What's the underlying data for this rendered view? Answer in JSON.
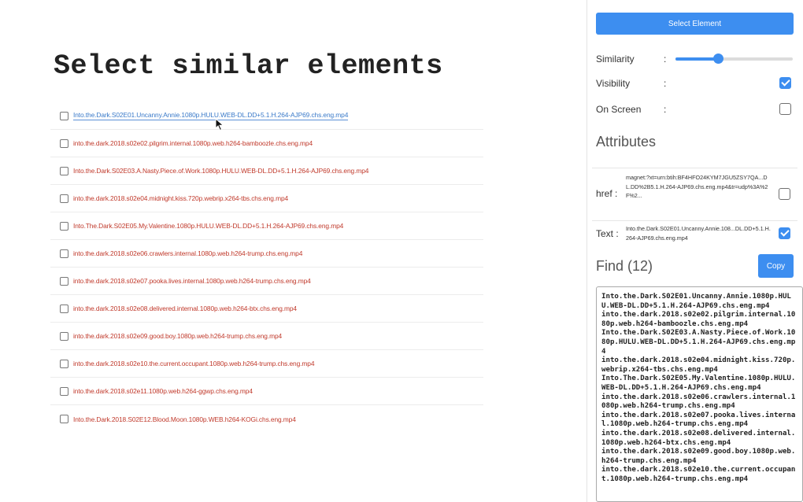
{
  "page": {
    "title": "Select similar elements",
    "files": [
      "Into.the.Dark.S02E01.Uncanny.Annie.1080p.HULU.WEB-DL.DD+5.1.H.264-AJP69.chs.eng.mp4",
      "into.the.dark.2018.s02e02.pilgrim.internal.1080p.web.h264-bamboozle.chs.eng.mp4",
      "Into.the.Dark.S02E03.A.Nasty.Piece.of.Work.1080p.HULU.WEB-DL.DD+5.1.H.264-AJP69.chs.eng.mp4",
      "into.the.dark.2018.s02e04.midnight.kiss.720p.webrip.x264-tbs.chs.eng.mp4",
      "Into.The.Dark.S02E05.My.Valentine.1080p.HULU.WEB-DL.DD+5.1.H.264-AJP69.chs.eng.mp4",
      "into.the.dark.2018.s02e06.crawlers.internal.1080p.web.h264-trump.chs.eng.mp4",
      "into.the.dark.2018.s02e07.pooka.lives.internal.1080p.web.h264-trump.chs.eng.mp4",
      "into.the.dark.2018.s02e08.delivered.internal.1080p.web.h264-btx.chs.eng.mp4",
      "into.the.dark.2018.s02e09.good.boy.1080p.web.h264-trump.chs.eng.mp4",
      "into.the.dark.2018.s02e10.the.current.occupant.1080p.web.h264-trump.chs.eng.mp4",
      "into.the.dark.2018.s02e11.1080p.web.h264-ggwp.chs.eng.mp4",
      "Into.the.Dark.2018.S02E12.Blood.Moon.1080p.WEB.h264-KOGi.chs.eng.mp4"
    ],
    "hovered_index": 0
  },
  "panel": {
    "select_button": "Select Element",
    "similarity": {
      "label": "Similarity",
      "colon": ":",
      "value": 0.36
    },
    "visibility": {
      "label": "Visibility",
      "colon": ":",
      "checked": true
    },
    "on_screen": {
      "label": "On Screen",
      "colon": ":",
      "checked": false
    },
    "attributes_heading": "Attributes",
    "attributes": [
      {
        "key": "href :",
        "value": "magnet:?xt=urn:btih:BF4HFO24KYM7JGU5ZSY7QA...DL.DD%2B5.1.H.264-AJP69.chs.eng.mp4&tr=udp%3A%2F%2...",
        "checked": false
      },
      {
        "key": "Text :",
        "value": "Into.the.Dark.S02E01.Uncanny.Annie.108...DL.DD+5.1.H.264-AJP69.chs.eng.mp4",
        "checked": true
      }
    ],
    "find_heading": "Find (12)",
    "copy_button": "Copy",
    "find_output": "Into.the.Dark.S02E01.Uncanny.Annie.1080p.HULU.WEB-DL.DD+5.1.H.264-AJP69.chs.eng.mp4\ninto.the.dark.2018.s02e02.pilgrim.internal.1080p.web.h264-bamboozle.chs.eng.mp4\nInto.the.Dark.S02E03.A.Nasty.Piece.of.Work.1080p.HULU.WEB-DL.DD+5.1.H.264-AJP69.chs.eng.mp4\ninto.the.dark.2018.s02e04.midnight.kiss.720p.webrip.x264-tbs.chs.eng.mp4\nInto.The.Dark.S02E05.My.Valentine.1080p.HULU.WEB-DL.DD+5.1.H.264-AJP69.chs.eng.mp4\ninto.the.dark.2018.s02e06.crawlers.internal.1080p.web.h264-trump.chs.eng.mp4\ninto.the.dark.2018.s02e07.pooka.lives.internal.1080p.web.h264-trump.chs.eng.mp4\ninto.the.dark.2018.s02e08.delivered.internal.1080p.web.h264-btx.chs.eng.mp4\ninto.the.dark.2018.s02e09.good.boy.1080p.web.h264-trump.chs.eng.mp4\ninto.the.dark.2018.s02e10.the.current.occupant.1080p.web.h264-trump.chs.eng.mp4"
  },
  "colors": {
    "accent": "#3d8ef0",
    "link": "#c0392b",
    "hovered_link": "#3a7ac9"
  },
  "icons": {
    "cursor": "mouse-pointer-icon",
    "check": "checkmark-icon"
  }
}
